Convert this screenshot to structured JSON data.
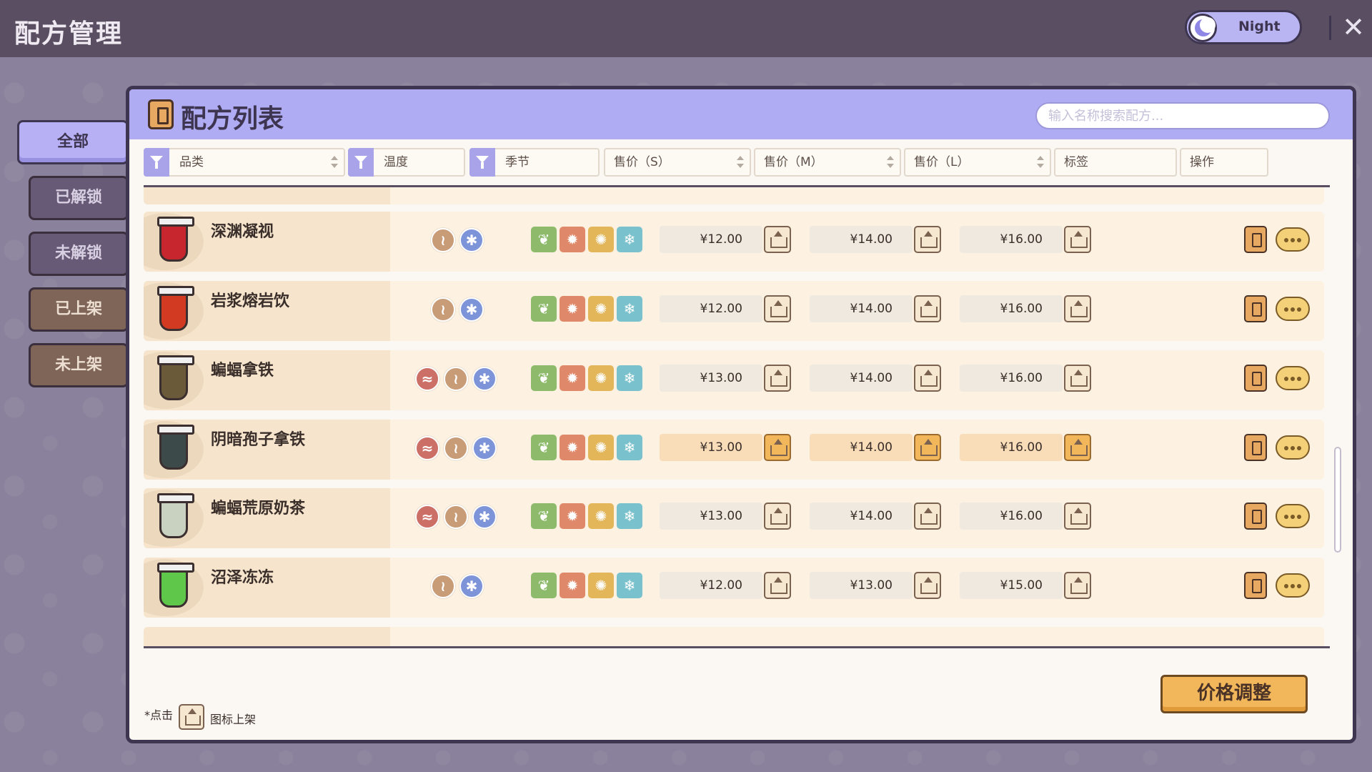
{
  "app": {
    "title": "配方管理",
    "night_label": "Night",
    "close_symbol": "✕"
  },
  "sidebar": {
    "tabs": [
      {
        "label": "全部",
        "style": "active"
      },
      {
        "label": "已解锁",
        "style": "purple"
      },
      {
        "label": "未解锁",
        "style": "purple"
      },
      {
        "label": "已上架",
        "style": "brown"
      },
      {
        "label": "未上架",
        "style": "brown"
      }
    ]
  },
  "panel": {
    "title": "配方列表",
    "search_placeholder": "输入名称搜索配方..."
  },
  "columns": {
    "category": "品类",
    "temperature": "温度",
    "season": "季节",
    "price_s": "售价（S）",
    "price_m": "售价（M）",
    "price_l": "售价（L）",
    "tags": "标签",
    "actions": "操作"
  },
  "rows": [
    {
      "name": "深渊凝视",
      "temps": [
        "warm",
        "ice"
      ],
      "price_s": "¥12.00",
      "price_m": "¥14.00",
      "price_l": "¥16.00",
      "highlight": false,
      "cup_color": "#c8262e"
    },
    {
      "name": "岩浆熔岩饮",
      "temps": [
        "warm",
        "ice"
      ],
      "price_s": "¥12.00",
      "price_m": "¥14.00",
      "price_l": "¥16.00",
      "highlight": false,
      "cup_color": "#d33a22"
    },
    {
      "name": "蝙蝠拿铁",
      "temps": [
        "hot",
        "warm",
        "ice"
      ],
      "price_s": "¥13.00",
      "price_m": "¥14.00",
      "price_l": "¥16.00",
      "highlight": false,
      "cup_color": "#6a5a3a"
    },
    {
      "name": "阴暗孢子拿铁",
      "temps": [
        "hot",
        "warm",
        "ice"
      ],
      "price_s": "¥13.00",
      "price_m": "¥14.00",
      "price_l": "¥16.00",
      "highlight": true,
      "cup_color": "#3d4a4a"
    },
    {
      "name": "蝙蝠荒原奶茶",
      "temps": [
        "hot",
        "warm",
        "ice"
      ],
      "price_s": "¥13.00",
      "price_m": "¥14.00",
      "price_l": "¥16.00",
      "highlight": false,
      "cup_color": "#c9d2c0"
    },
    {
      "name": "沼泽冻冻",
      "temps": [
        "warm",
        "ice"
      ],
      "price_s": "¥12.00",
      "price_m": "¥13.00",
      "price_l": "¥15.00",
      "highlight": false,
      "cup_color": "#5fc74a"
    }
  ],
  "icons": {
    "temp_hot": "heat-waves-icon",
    "temp_warm": "warm-icon",
    "temp_ice": "snowflake-icon",
    "seasons": [
      "leaf-icon",
      "sun-icon",
      "maple-leaf-icon",
      "snowflake-icon"
    ],
    "season_glyphs": [
      "❦",
      "✹",
      "✺",
      "❄"
    ],
    "temp_glyphs": {
      "hot": "≈",
      "warm": "≀",
      "ice": "✱"
    }
  },
  "footer": {
    "hint_prefix": "*点击",
    "hint_suffix": "图标上架",
    "price_adjust_label": "价格调整"
  }
}
